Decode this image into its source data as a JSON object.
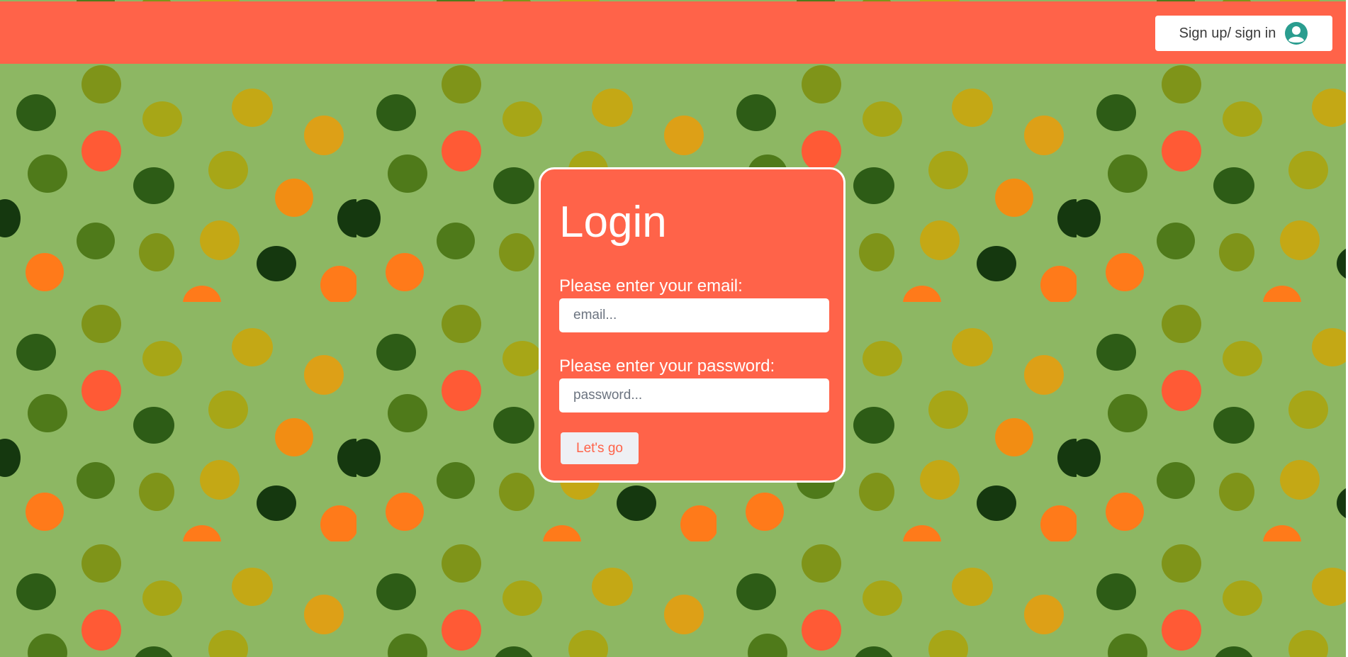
{
  "header": {
    "background_color": "#ff6349",
    "signin_label": "Sign up/ sign in",
    "signin_icon": "user-circle-icon",
    "icon_color": "#2a9d8f"
  },
  "background": {
    "base_color": "#8db763",
    "pattern": "polka-dots",
    "dot_colors": [
      "#2d5c16",
      "#15380f",
      "#4f7a1a",
      "#7f9419",
      "#a7a617",
      "#c4a815",
      "#dda017",
      "#f28d13",
      "#ff7a1a",
      "#ff5a35"
    ]
  },
  "login": {
    "title": "Login",
    "email_label": "Please enter your email:",
    "email_placeholder": "email...",
    "email_value": "",
    "password_label": "Please enter your password:",
    "password_placeholder": "password...",
    "password_value": "",
    "submit_label": "Let's go"
  }
}
